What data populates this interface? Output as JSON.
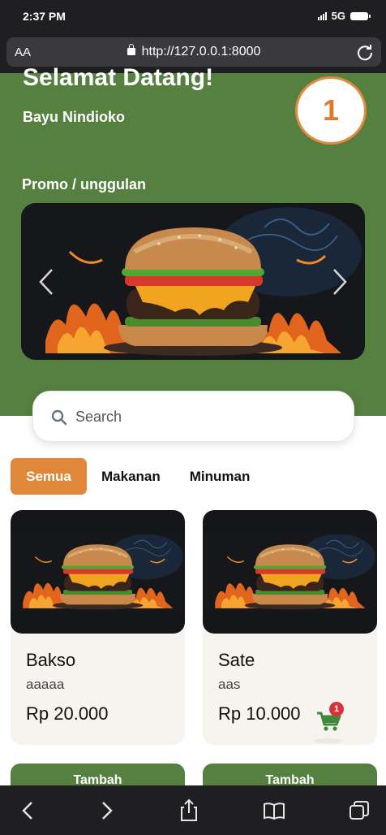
{
  "status_bar": {
    "time": "2:37 PM",
    "network": "5G"
  },
  "browser": {
    "text_size_label": "AA",
    "url": "http://127.0.0.1:8000"
  },
  "header": {
    "greeting": "Selamat Datang!",
    "user_name": "Bayu Nindioko",
    "cart_count": "1",
    "promo_title": "Promo / unggulan"
  },
  "search": {
    "placeholder": "Search",
    "value": ""
  },
  "categories": {
    "tabs": [
      {
        "label": "Semua",
        "active": true
      },
      {
        "label": "Makanan",
        "active": false
      },
      {
        "label": "Minuman",
        "active": false
      }
    ]
  },
  "products": [
    {
      "name": "Bakso",
      "description": "aaaaa",
      "price": "Rp 20.000",
      "add_label": "Tambah"
    },
    {
      "name": "Sate",
      "description": "aas",
      "price": "Rp 10.000",
      "add_label": "Tambah"
    }
  ],
  "floating_cart": {
    "badge": "1"
  },
  "colors": {
    "header_green": "#55803f",
    "accent_orange": "#e0873a",
    "badge_red": "#d8333a",
    "card_bg": "#f7f4ef"
  },
  "icons": {
    "status": [
      "signal-icon",
      "battery-icon"
    ],
    "browser": [
      "lock-icon",
      "reload-icon"
    ],
    "carousel": [
      "chevron-left-icon",
      "chevron-right-icon"
    ],
    "toolbar": [
      "back-icon",
      "forward-icon",
      "share-icon",
      "bookmarks-icon",
      "tabs-icon"
    ]
  }
}
